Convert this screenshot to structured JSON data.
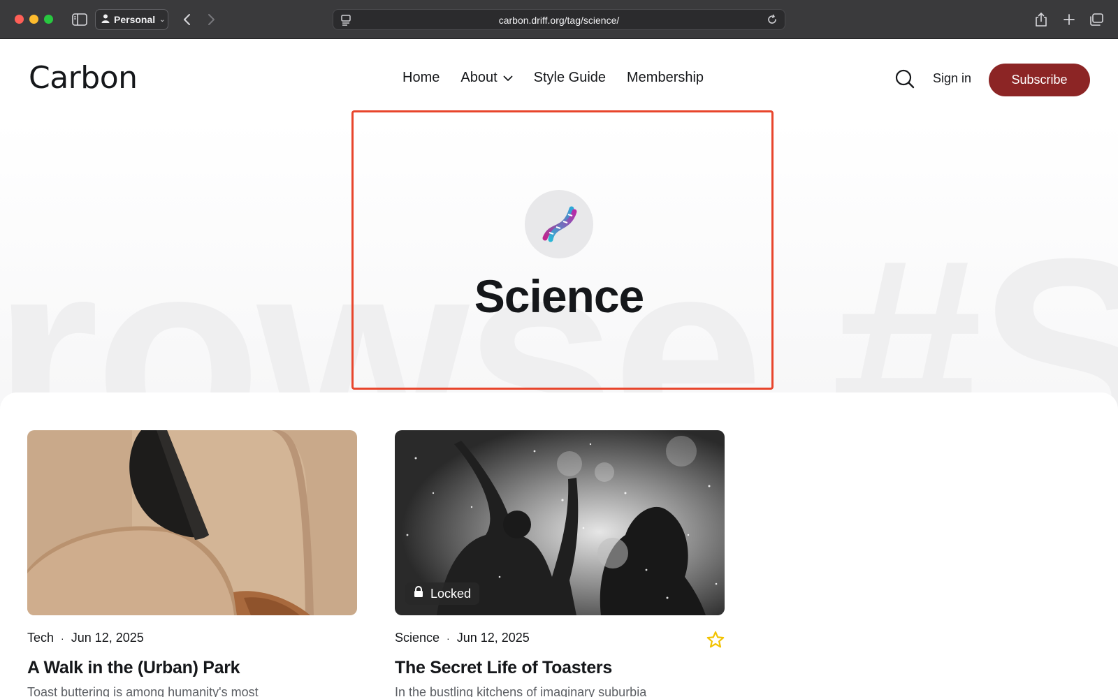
{
  "browser": {
    "profile_label": "Personal",
    "url": "carbon.driff.org/tag/science/"
  },
  "site": {
    "logo": "Carbon",
    "nav": [
      {
        "label": "Home"
      },
      {
        "label": "About"
      },
      {
        "label": "Style Guide"
      },
      {
        "label": "Membership"
      }
    ],
    "signin_label": "Sign in",
    "subscribe_label": "Subscribe"
  },
  "hero": {
    "watermark": "rowse #S",
    "tag_icon": "dna-icon",
    "tag_title": "Science"
  },
  "posts": [
    {
      "tag": "Tech",
      "date": "Jun 12, 2025",
      "title": "A Walk in the (Urban) Park",
      "excerpt": "Toast buttering is among humanity's most",
      "locked": false
    },
    {
      "tag": "Science",
      "date": "Jun 12, 2025",
      "title": "The Secret Life of Toasters",
      "excerpt": "In the bustling kitchens of imaginary suburbia",
      "locked": true,
      "locked_label": "Locked",
      "featured": true
    }
  ],
  "colors": {
    "accent": "#8c2525",
    "highlight": "#e8452c",
    "star": "#f2c200"
  }
}
